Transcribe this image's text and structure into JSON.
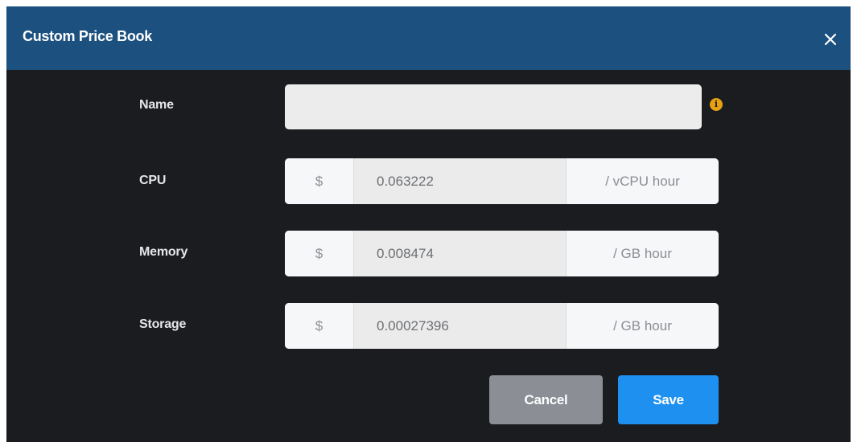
{
  "dialog": {
    "title": "Custom Price Book",
    "close_icon": "close-icon"
  },
  "form": {
    "name": {
      "label": "Name",
      "value": "",
      "info_icon": "info-icon"
    },
    "cpu": {
      "label": "CPU",
      "prefix": "$",
      "value": "0.063222",
      "suffix": "/ vCPU hour"
    },
    "memory": {
      "label": "Memory",
      "prefix": "$",
      "value": "0.008474",
      "suffix": "/ GB hour"
    },
    "storage": {
      "label": "Storage",
      "prefix": "$",
      "value": "0.00027396",
      "suffix": "/ GB hour"
    }
  },
  "actions": {
    "cancel_label": "Cancel",
    "save_label": "Save"
  },
  "colors": {
    "header": "#1c507e",
    "body": "#1b1c20",
    "save": "#1e90f0",
    "cancel": "#8b8f95",
    "info": "#e6a011"
  }
}
